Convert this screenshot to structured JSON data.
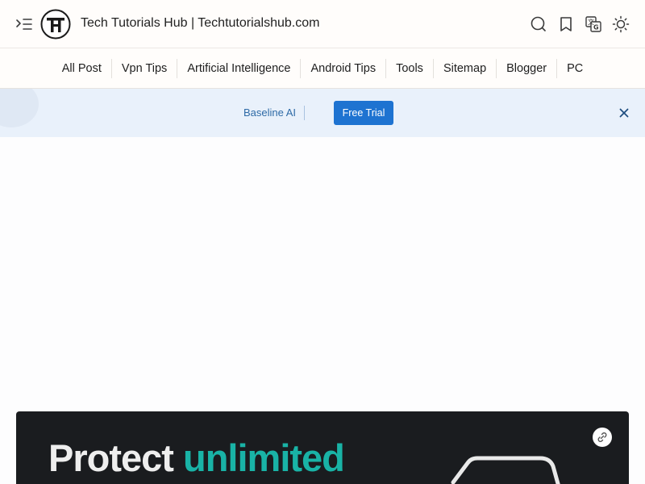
{
  "header": {
    "site_title": "Tech Tutorials Hub | Techtutorialshub.com",
    "icons": [
      "menu-icon",
      "site-logo",
      "search-icon",
      "bookmark-icon",
      "translate-icon",
      "theme-toggle-icon"
    ]
  },
  "nav": {
    "items": [
      "All Post",
      "Vpn Tips",
      "Artificial Intelligence",
      "Android Tips",
      "Tools",
      "Sitemap",
      "Blogger",
      "PC"
    ]
  },
  "banner": {
    "text": "Baseline AI",
    "button_label": "Free Trial"
  },
  "ad": {
    "headline_part1": "Protect",
    "headline_part2": "unlimited"
  },
  "colors": {
    "accent": "#1e73d1",
    "banner_bg": "#e9f1fb",
    "ad_bg": "#1a1c1f",
    "ad_highlight": "#19b3a6"
  }
}
